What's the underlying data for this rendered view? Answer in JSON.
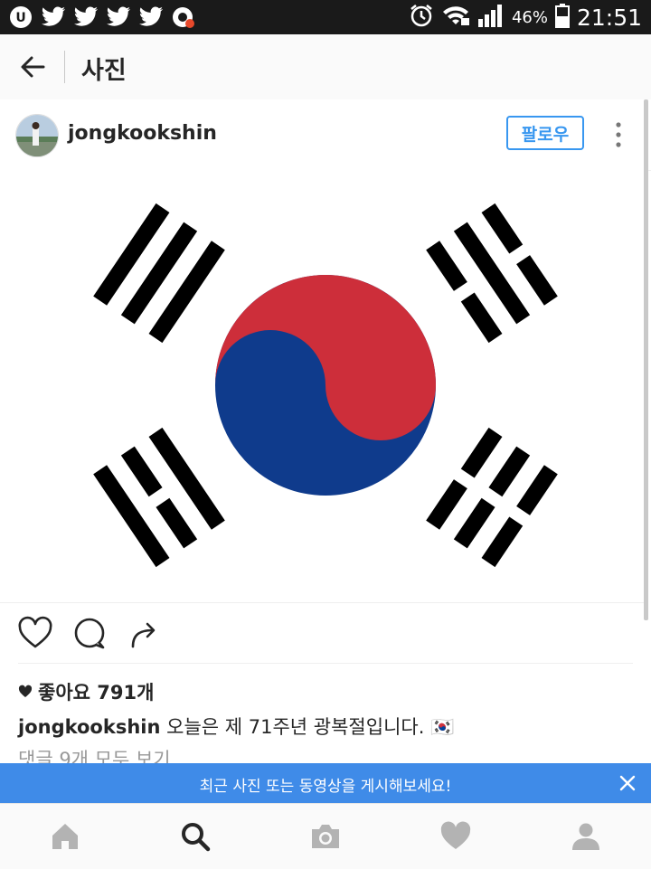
{
  "status_bar": {
    "battery_percent": "46%",
    "time": "21:51",
    "left_icons": [
      "uplus-icon",
      "twitter-icon",
      "twitter-icon",
      "twitter-icon",
      "twitter-icon",
      "notification-app-icon"
    ]
  },
  "header": {
    "title": "사진"
  },
  "post": {
    "username": "jongkookshin",
    "follow_label": "팔로우",
    "image_subject": "taegukgi",
    "likes_label": "좋아요 791개",
    "caption_user": "jongkookshin",
    "caption_text": "오늘은 제 71주년 광복절입니다. 🇰🇷",
    "comments_link": "댓글 9개 모두 보기"
  },
  "banner": {
    "text": "최근 사진 또는 동영상을 게시해보세요!"
  },
  "bottom_nav": {
    "items": [
      "home-icon",
      "search-icon",
      "camera-icon",
      "heart-icon",
      "profile-icon"
    ],
    "active": "search-icon"
  },
  "colors": {
    "accent": "#3897f0",
    "banner": "#3f8be8",
    "flag_red": "#cd2e3a",
    "flag_blue": "#0f3b8c"
  }
}
